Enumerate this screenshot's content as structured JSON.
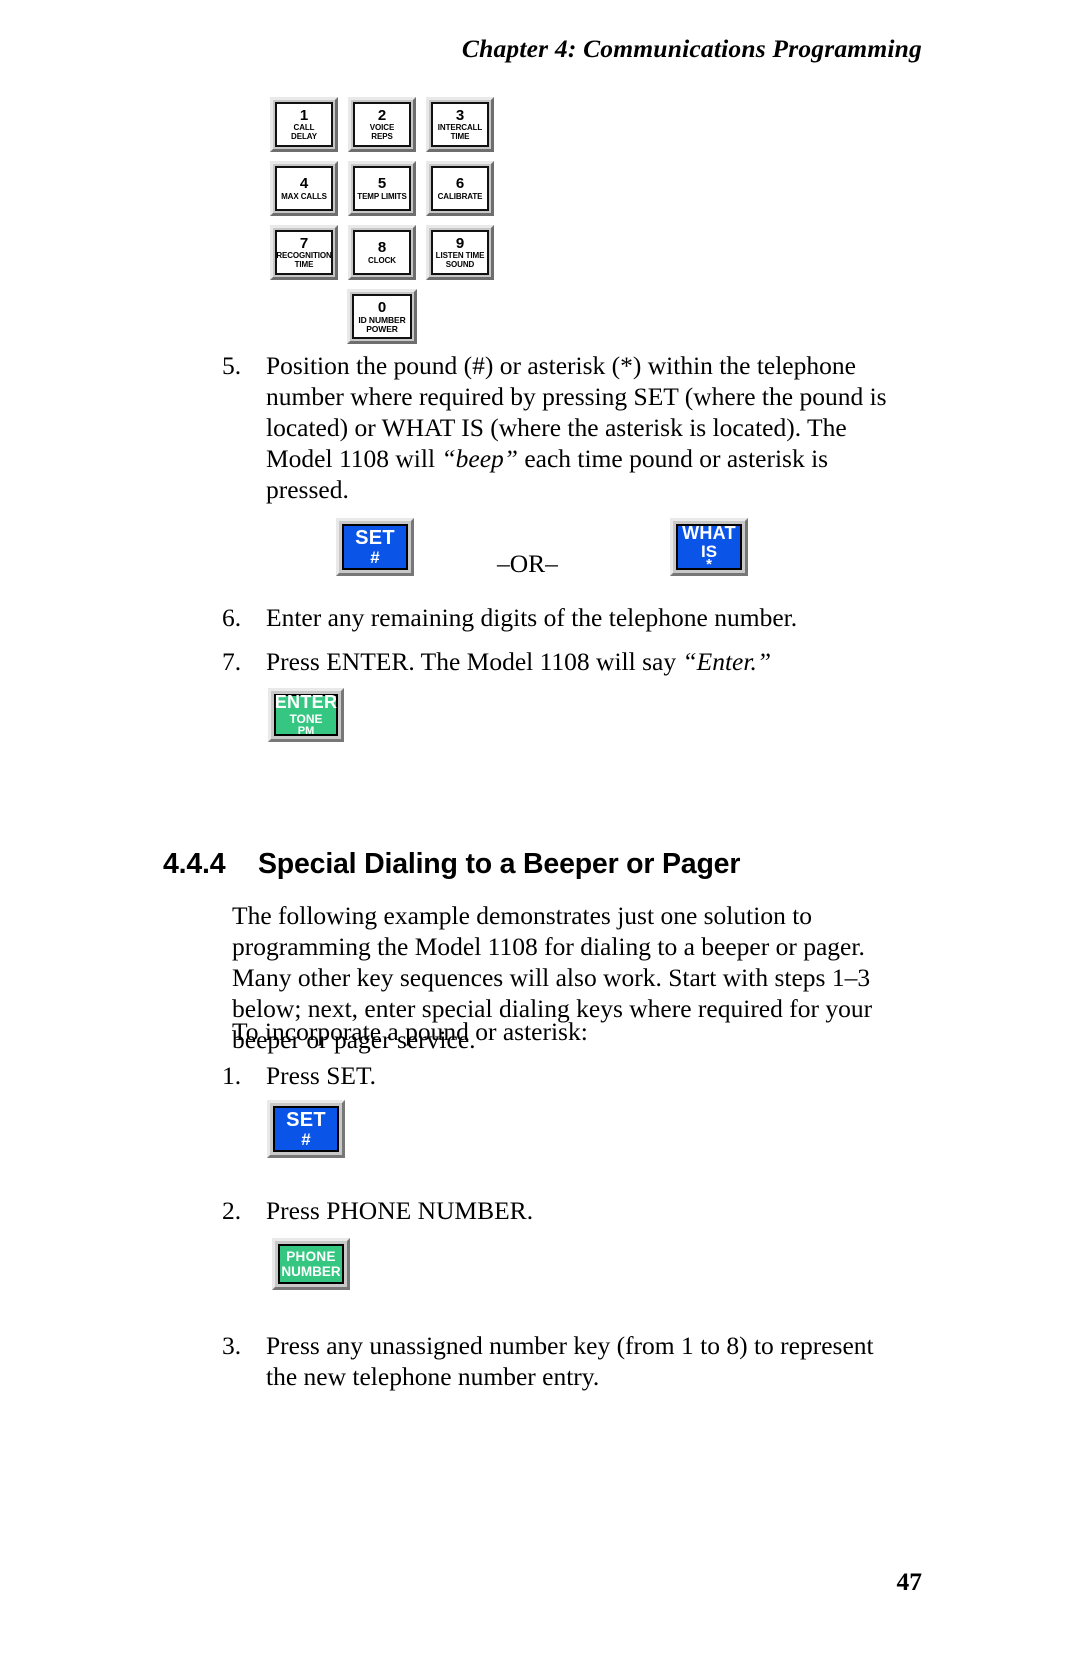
{
  "header": {
    "running_head": "Chapter 4:  Communications Programming"
  },
  "keypad": {
    "rows": [
      [
        {
          "number": "1",
          "label_line1": "CALL",
          "label_line2": "DELAY"
        },
        {
          "number": "2",
          "label_line1": "VOICE",
          "label_line2": "REPS"
        },
        {
          "number": "3",
          "label_line1": "INTERCALL",
          "label_line2": "TIME"
        }
      ],
      [
        {
          "number": "4",
          "label_line1": "MAX CALLS",
          "label_line2": ""
        },
        {
          "number": "5",
          "label_line1": "TEMP LIMITS",
          "label_line2": ""
        },
        {
          "number": "6",
          "label_line1": "CALIBRATE",
          "label_line2": ""
        }
      ],
      [
        {
          "number": "7",
          "label_line1": "RECOGNITION",
          "label_line2": "TIME"
        },
        {
          "number": "8",
          "label_line1": "CLOCK",
          "label_line2": ""
        },
        {
          "number": "9",
          "label_line1": "LISTEN TIME",
          "label_line2": "SOUND"
        }
      ]
    ],
    "zero_key": {
      "number": "0",
      "label_line1": "ID NUMBER",
      "label_line2": "POWER"
    }
  },
  "steps": {
    "step5": {
      "marker": "5.",
      "line1": "Position the pound (#) or asterisk (*) within the telephone",
      "line2": "number where required by pressing SET (where the pound is",
      "line3": "located) or WHAT IS  (where the asterisk is located).  The",
      "line4_pre": "Model 1108 will ",
      "line4_em": "“beep”",
      "line4_post": " each time pound or asterisk is",
      "line5": "pressed."
    },
    "step6": {
      "marker": "6.",
      "text": "Enter any remaining digits of the telephone number."
    },
    "step7": {
      "marker": "7.",
      "text_pre": "Press ENTER. The Model 1108 will say ",
      "text_em": "“Enter.”"
    },
    "sub_step1": {
      "marker": "1.",
      "text": "Press SET."
    },
    "sub_step2": {
      "marker": "2.",
      "text": "Press PHONE NUMBER."
    },
    "sub_step3": {
      "marker": "3.",
      "line1": "Press any unassigned number key (from 1 to 8) to represent",
      "line2": "the new telephone number entry."
    }
  },
  "buttons": {
    "set": {
      "line1": "SET",
      "line2": "#",
      "color": "#0a54e8"
    },
    "what_is": {
      "line1": "WHAT",
      "line2": "IS",
      "line3": "*",
      "color": "#0a54e8"
    },
    "enter": {
      "line1": "ENTER",
      "line2": "TONE",
      "line3": "PM",
      "color": "#35c781"
    },
    "phone_number": {
      "line1": "PHONE",
      "line2": "NUMBER",
      "color": "#35c781"
    },
    "or_separator": "–OR–"
  },
  "section": {
    "number": "4.4.4",
    "title": "Special Dialing to a Beeper or Pager",
    "body": {
      "line1": "The following example demonstrates just one solution to",
      "line2": "programming the Model 1108 for dialing to a beeper or pager.",
      "line3": "Many other key sequences will also work. Start with steps 1–3",
      "line4": "below; next, enter special dialing keys where required for your",
      "line5": "beeper or pager service."
    },
    "lead_in": "To incorporate a pound or asterisk:"
  },
  "footer": {
    "page_number": "47"
  }
}
